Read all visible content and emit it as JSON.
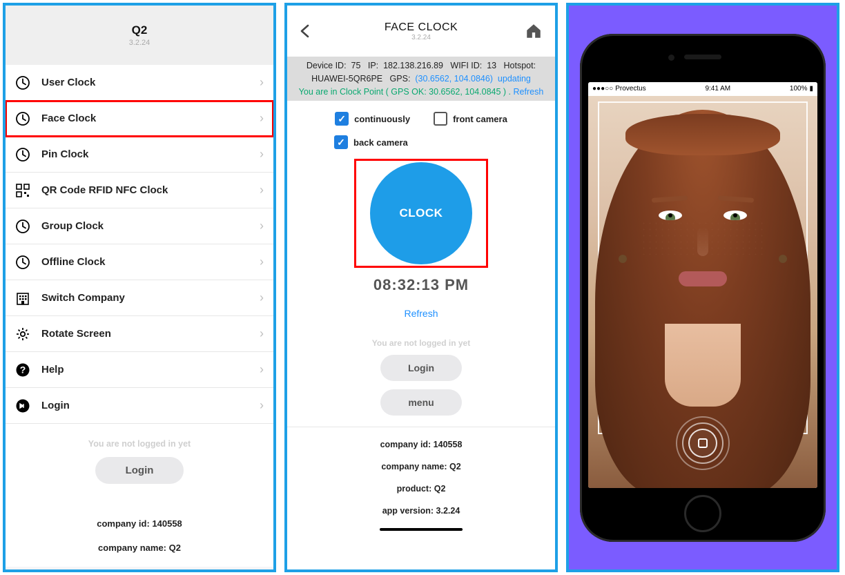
{
  "panel1": {
    "header": {
      "title": "Q2",
      "version": "3.2.24"
    },
    "items": [
      {
        "icon": "clock-icon",
        "label": "User Clock",
        "highlight": false
      },
      {
        "icon": "clock-icon",
        "label": "Face Clock",
        "highlight": true
      },
      {
        "icon": "clock-icon",
        "label": "Pin Clock",
        "highlight": false
      },
      {
        "icon": "qr-icon",
        "label": "QR Code RFID NFC Clock",
        "highlight": false
      },
      {
        "icon": "clock-icon",
        "label": "Group Clock",
        "highlight": false
      },
      {
        "icon": "clock-icon",
        "label": "Offline Clock",
        "highlight": false
      },
      {
        "icon": "building-icon",
        "label": "Switch Company",
        "highlight": false
      },
      {
        "icon": "gear-icon",
        "label": "Rotate Screen",
        "highlight": false
      },
      {
        "icon": "help-icon",
        "label": "Help",
        "highlight": false
      },
      {
        "icon": "login-icon",
        "label": "Login",
        "highlight": false
      }
    ],
    "footer": {
      "not_logged": "You are not logged in yet",
      "login_btn": "Login"
    },
    "meta": {
      "company_id": "company id: 140558",
      "company_name": "company name: Q2"
    }
  },
  "panel2": {
    "header": {
      "title": "FACE CLOCK",
      "version": "3.2.24"
    },
    "info": {
      "device_lbl": "Device ID:",
      "device_val": "75",
      "ip_lbl": "IP:",
      "ip_val": "182.138.216.89",
      "wifi_lbl": "WIFI ID:",
      "wifi_val": "13",
      "hotspot_lbl": "Hotspot:",
      "hotspot_val": "HUAWEI-5QR6PE",
      "gps_lbl": "GPS:",
      "gps_val": "(30.6562, 104.0846)",
      "gps_status": "updating",
      "clockpoint_pre": "You are in Clock Point ( GPS OK: 30.6562, 104.0845 ) .",
      "refresh": "Refresh"
    },
    "checks": {
      "continuously": {
        "label": "continuously",
        "checked": true
      },
      "front_camera": {
        "label": "front camera",
        "checked": false
      },
      "back_camera": {
        "label": "back camera",
        "checked": true
      }
    },
    "clock_btn": "CLOCK",
    "time": "08:32:13 PM",
    "refresh_link": "Refresh",
    "not_logged": "You are not logged in yet",
    "login_btn": "Login",
    "menu_btn": "menu",
    "meta": {
      "company_id": "company id: 140558",
      "company_name": "company name: Q2",
      "product": "product: Q2",
      "app_version": "app version: 3.2.24"
    }
  },
  "panel3": {
    "statusbar": {
      "carrier": "Provectus",
      "time": "9:41 AM",
      "battery": "100%"
    }
  }
}
